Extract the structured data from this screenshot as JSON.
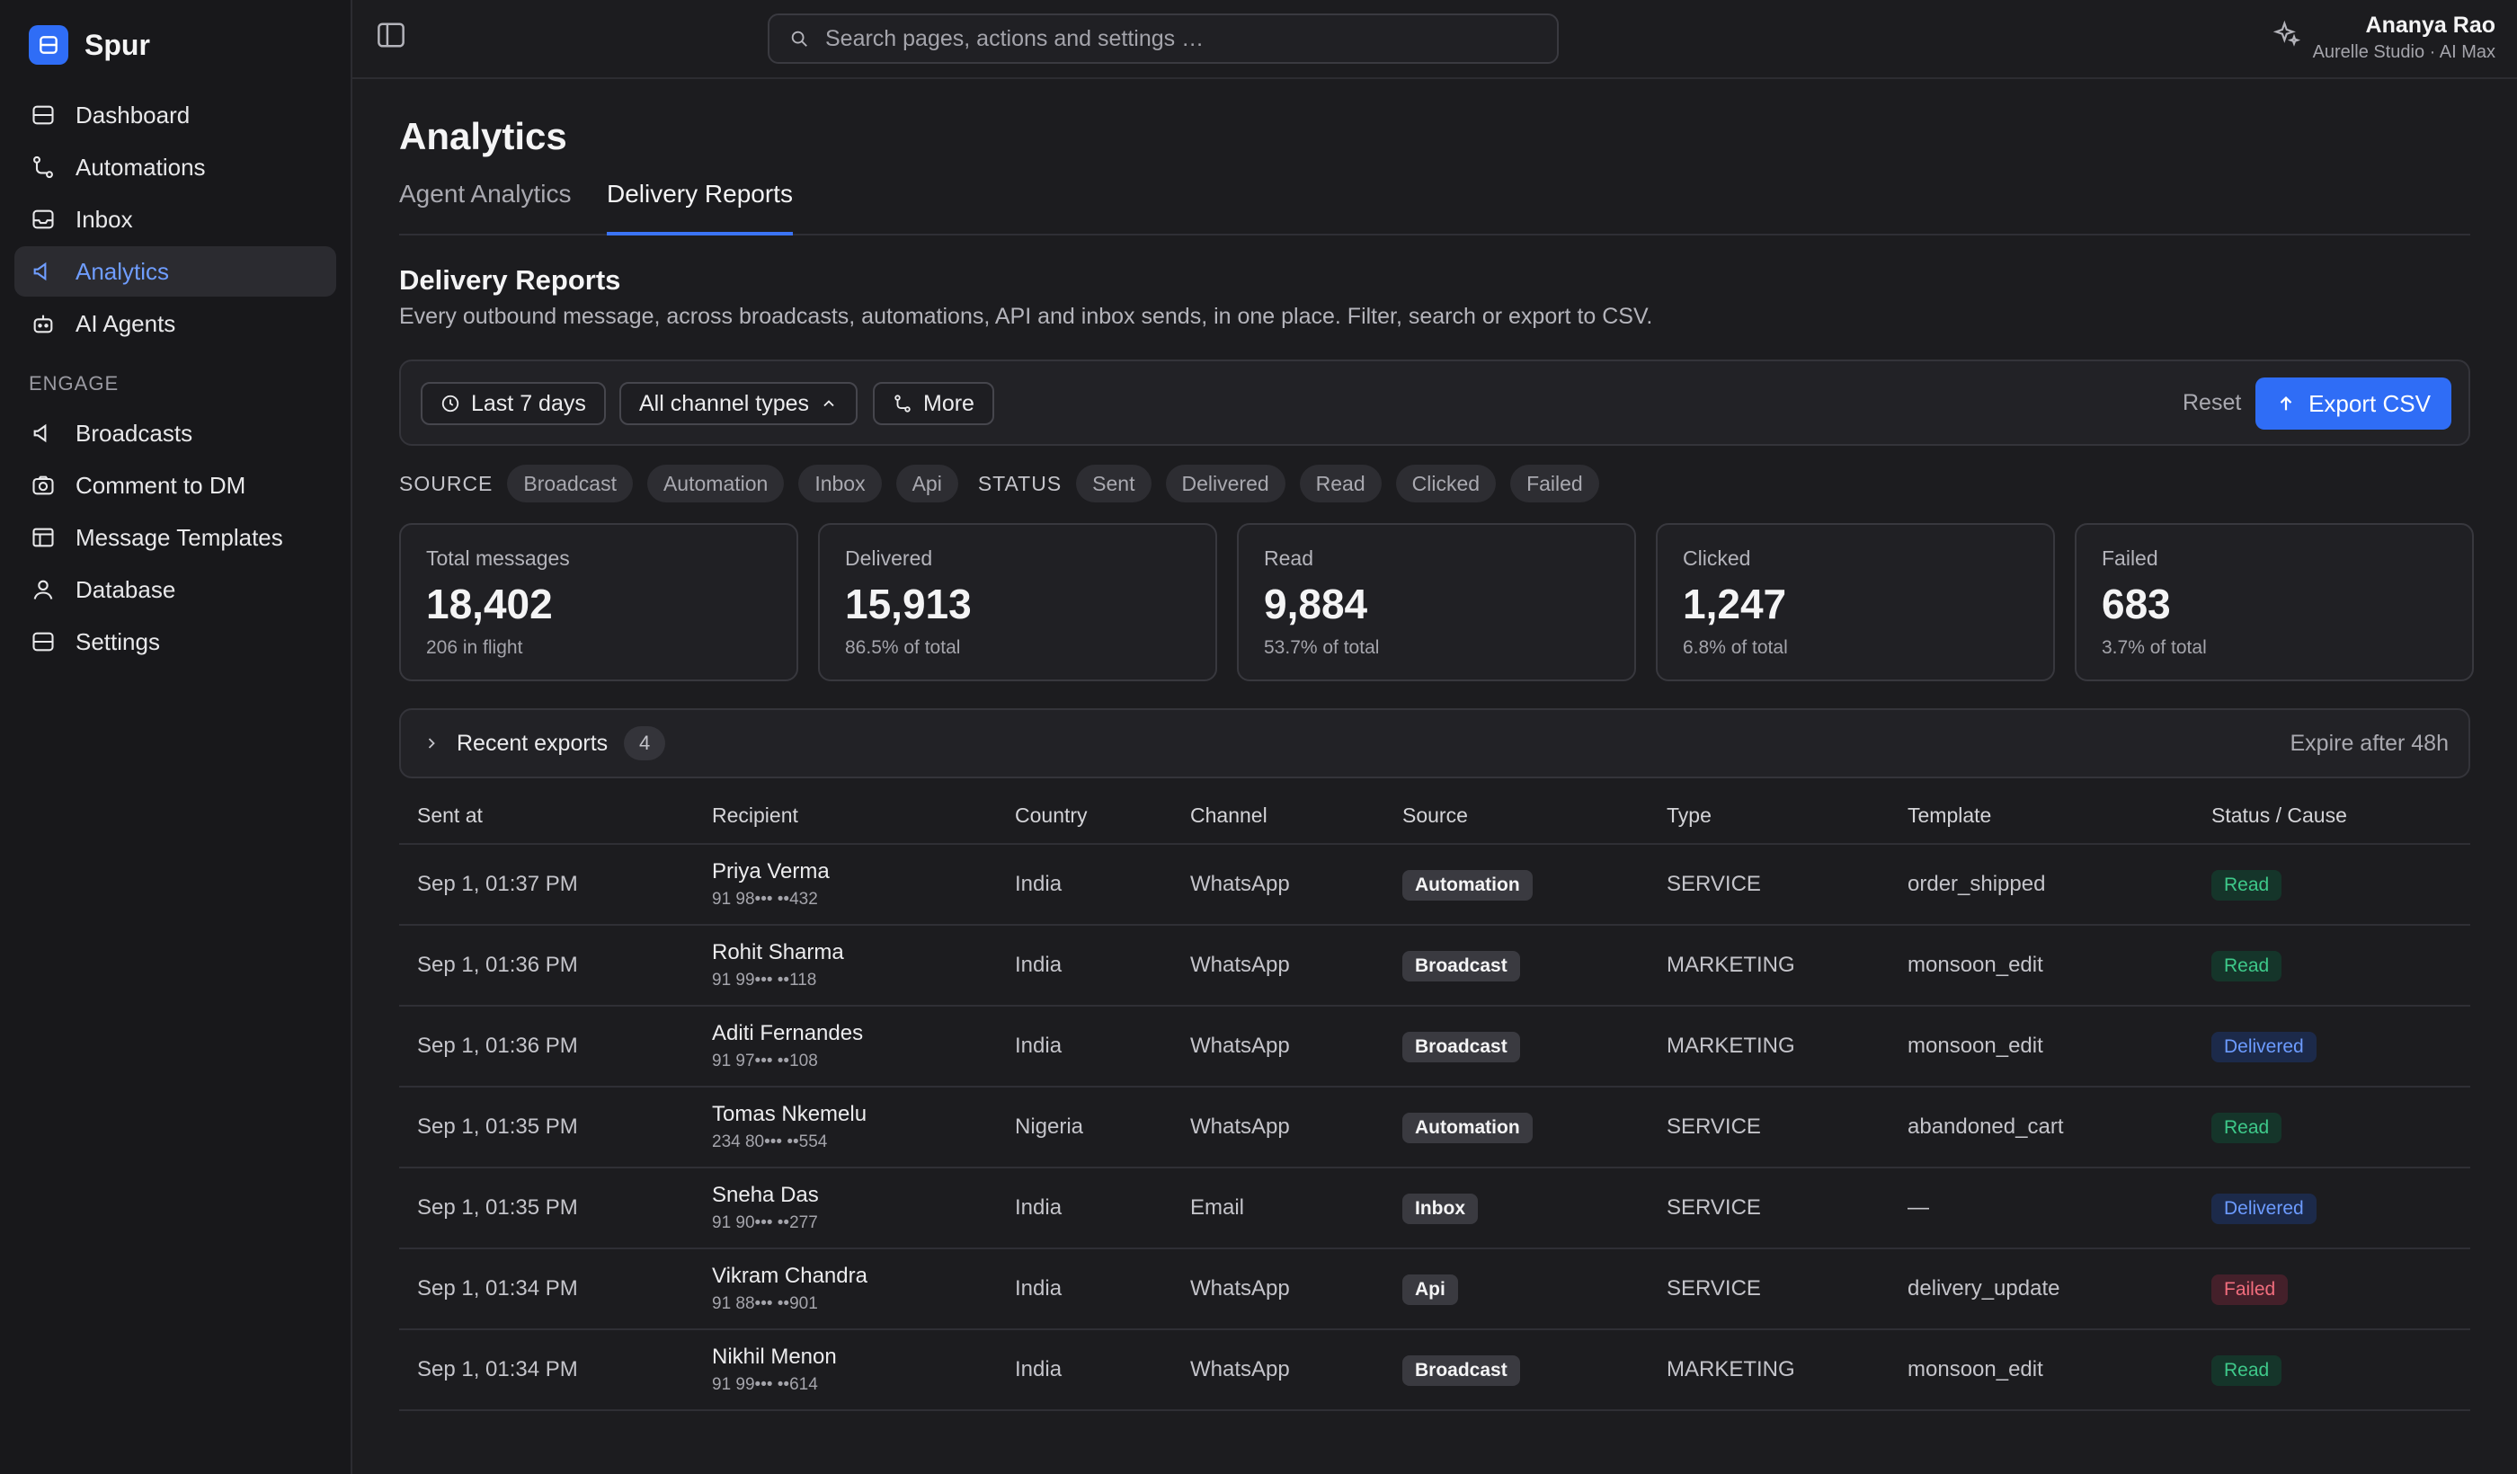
{
  "app": {
    "brand": "Spur"
  },
  "sidebar": {
    "items": [
      {
        "label": "Dashboard",
        "icon": "dashboard-icon",
        "active": false
      },
      {
        "label": "Automations",
        "icon": "workflow-icon",
        "active": false
      },
      {
        "label": "Inbox",
        "icon": "inbox-icon",
        "active": false
      },
      {
        "label": "Analytics",
        "icon": "megaphone-icon",
        "active": true
      },
      {
        "label": "AI Agents",
        "icon": "bot-icon",
        "active": false
      }
    ],
    "section_label": "ENGAGE",
    "engage_items": [
      {
        "label": "Broadcasts",
        "icon": "megaphone-icon"
      },
      {
        "label": "Comment to DM",
        "icon": "camera-icon"
      },
      {
        "label": "Message Templates",
        "icon": "template-icon"
      },
      {
        "label": "Database",
        "icon": "user-icon"
      },
      {
        "label": "Settings",
        "icon": "settings-icon"
      }
    ]
  },
  "topbar": {
    "search_placeholder": "Search pages, actions and settings …",
    "user_name": "Ananya Rao",
    "user_org": "Aurelle Studio · AI Max"
  },
  "page": {
    "title": "Analytics",
    "tabs": [
      {
        "label": "Agent Analytics",
        "active": false
      },
      {
        "label": "Delivery Reports",
        "active": true
      }
    ],
    "section_title": "Delivery Reports",
    "section_desc": "Every outbound message, across broadcasts, automations, API and inbox sends, in one place. Filter, search or export to CSV."
  },
  "filters": {
    "date": "Last 7 days",
    "channel": "All channel types",
    "more": "More",
    "reset": "Reset",
    "export": "Export CSV"
  },
  "chips": {
    "source_label": "SOURCE",
    "sources": [
      "Broadcast",
      "Automation",
      "Inbox",
      "Api"
    ],
    "status_label": "STATUS",
    "statuses": [
      "Sent",
      "Delivered",
      "Read",
      "Clicked",
      "Failed"
    ]
  },
  "stats": [
    {
      "label": "Total messages",
      "value": "18,402",
      "sub": "206 in flight"
    },
    {
      "label": "Delivered",
      "value": "15,913",
      "sub": "86.5% of total"
    },
    {
      "label": "Read",
      "value": "9,884",
      "sub": "53.7% of total"
    },
    {
      "label": "Clicked",
      "value": "1,247",
      "sub": "6.8% of total"
    },
    {
      "label": "Failed",
      "value": "683",
      "sub": "3.7% of total"
    }
  ],
  "recent_exports": {
    "title": "Recent exports",
    "count": "4",
    "expire": "Expire after 48h"
  },
  "table": {
    "headers": [
      "Sent at",
      "Recipient",
      "Country",
      "Channel",
      "Source",
      "Type",
      "Template",
      "Status / Cause"
    ],
    "rows": [
      {
        "sent_at": "Sep 1, 01:37 PM",
        "name": "Priya Verma",
        "phone": "91 98••• ••432",
        "country": "India",
        "channel": "WhatsApp",
        "source": "Automation",
        "type": "SERVICE",
        "template": "order_shipped",
        "status": "Read",
        "status_kind": "read"
      },
      {
        "sent_at": "Sep 1, 01:36 PM",
        "name": "Rohit Sharma",
        "phone": "91 99••• ••118",
        "country": "India",
        "channel": "WhatsApp",
        "source": "Broadcast",
        "type": "MARKETING",
        "template": "monsoon_edit",
        "status": "Read",
        "status_kind": "read"
      },
      {
        "sent_at": "Sep 1, 01:36 PM",
        "name": "Aditi Fernandes",
        "phone": "91 97••• ••108",
        "country": "India",
        "channel": "WhatsApp",
        "source": "Broadcast",
        "type": "MARKETING",
        "template": "monsoon_edit",
        "status": "Delivered",
        "status_kind": "delivered"
      },
      {
        "sent_at": "Sep 1, 01:35 PM",
        "name": "Tomas Nkemelu",
        "phone": "234 80••• ••554",
        "country": "Nigeria",
        "channel": "WhatsApp",
        "source": "Automation",
        "type": "SERVICE",
        "template": "abandoned_cart",
        "status": "Read",
        "status_kind": "read"
      },
      {
        "sent_at": "Sep 1, 01:35 PM",
        "name": "Sneha Das",
        "phone": "91 90••• ••277",
        "country": "India",
        "channel": "Email",
        "source": "Inbox",
        "type": "SERVICE",
        "template": "—",
        "status": "Delivered",
        "status_kind": "delivered"
      },
      {
        "sent_at": "Sep 1, 01:34 PM",
        "name": "Vikram Chandra",
        "phone": "91 88••• ••901",
        "country": "India",
        "channel": "WhatsApp",
        "source": "Api",
        "type": "SERVICE",
        "template": "delivery_update",
        "status": "Failed",
        "status_kind": "failed"
      },
      {
        "sent_at": "Sep 1, 01:34 PM",
        "name": "Nikhil Menon",
        "phone": "91 99••• ••614",
        "country": "India",
        "channel": "WhatsApp",
        "source": "Broadcast",
        "type": "MARKETING",
        "template": "monsoon_edit",
        "status": "Read",
        "status_kind": "read"
      }
    ]
  },
  "colors": {
    "accent": "#2f6df6",
    "read": "#3ec98a",
    "delivered": "#6c9bff",
    "failed": "#f26d7d"
  }
}
